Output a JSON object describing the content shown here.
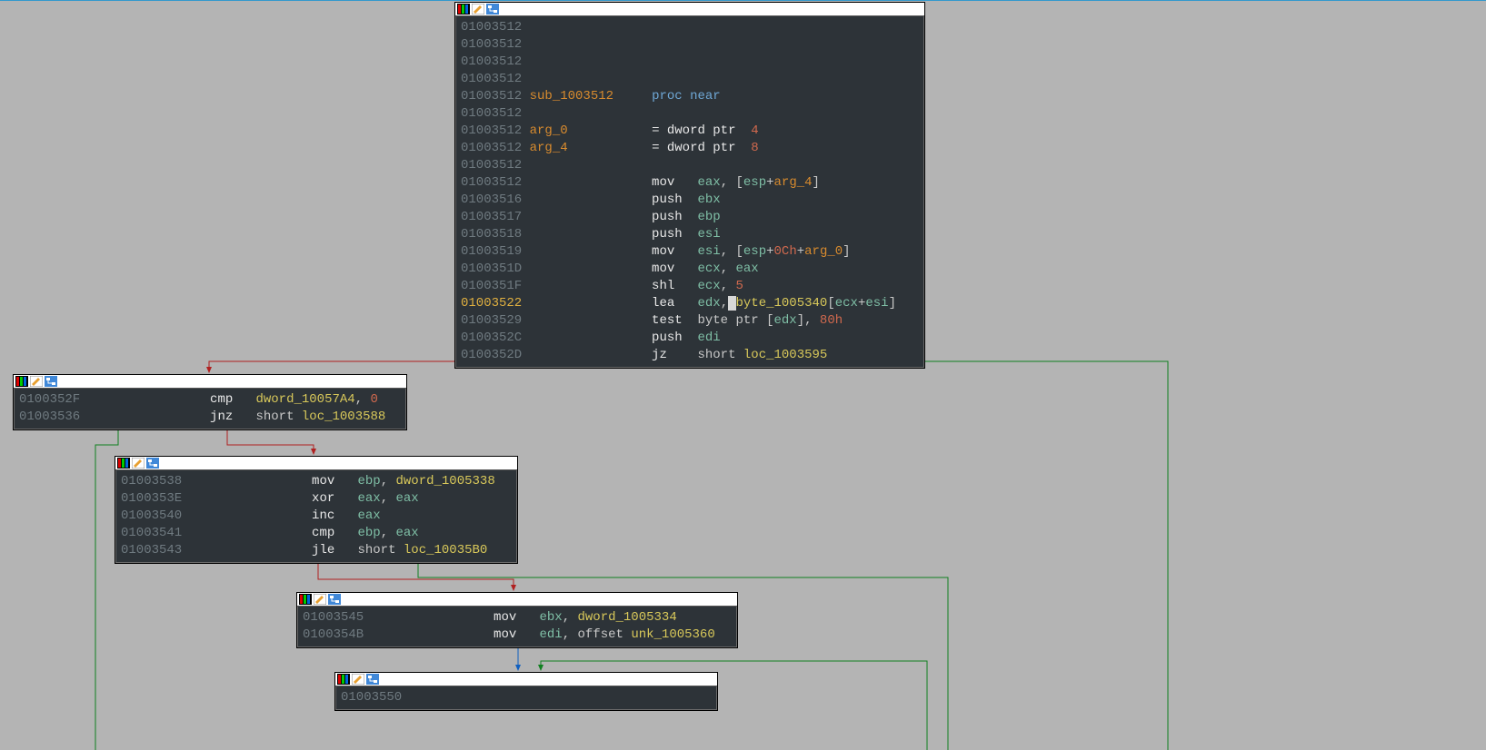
{
  "blocks": {
    "main": {
      "lines": [
        {
          "addr": "01003512",
          "asm": ""
        },
        {
          "addr": "01003512",
          "asm": ""
        },
        {
          "addr": "01003512",
          "asm": ""
        },
        {
          "addr": "01003512",
          "asm": ""
        },
        {
          "addr": "01003512",
          "asm": "<span class='id'>sub_1003512</span>     <span class='kw'>proc near</span>"
        },
        {
          "addr": "01003512",
          "asm": ""
        },
        {
          "addr": "01003512",
          "asm": "<span class='id'>arg_0</span>           <span class='op'>= dword ptr  </span><span class='num'>4</span>"
        },
        {
          "addr": "01003512",
          "asm": "<span class='id'>arg_4</span>           <span class='op'>= dword ptr  </span><span class='num'>8</span>"
        },
        {
          "addr": "01003512",
          "asm": ""
        },
        {
          "addr": "01003512",
          "asm": "                <span class='op'>mov   </span><span class='reg'>eax</span><span class='txt'>, [</span><span class='reg'>esp</span><span class='txt'>+</span><span class='id'>arg_4</span><span class='txt'>]</span>"
        },
        {
          "addr": "01003516",
          "asm": "                <span class='op'>push  </span><span class='reg'>ebx</span>"
        },
        {
          "addr": "01003517",
          "asm": "                <span class='op'>push  </span><span class='reg'>ebp</span>"
        },
        {
          "addr": "01003518",
          "asm": "                <span class='op'>push  </span><span class='reg'>esi</span>"
        },
        {
          "addr": "01003519",
          "asm": "                <span class='op'>mov   </span><span class='reg'>esi</span><span class='txt'>, [</span><span class='reg'>esp</span><span class='txt'>+</span><span class='num'>0Ch</span><span class='txt'>+</span><span class='id'>arg_0</span><span class='txt'>]</span>"
        },
        {
          "addr": "0100351D",
          "asm": "                <span class='op'>mov   </span><span class='reg'>ecx</span><span class='txt'>, </span><span class='reg'>eax</span>"
        },
        {
          "addr": "0100351F",
          "asm": "                <span class='op'>shl   </span><span class='reg'>ecx</span><span class='txt'>, </span><span class='num'>5</span>"
        },
        {
          "addr": "01003522",
          "hi": true,
          "asm": "                <span class='op'>lea   </span><span class='reg'>edx</span><span class='txt'>,</span><span style='background:#d8d8d8;color:#000'>&nbsp;</span><span class='lbl'>byte_1005340</span><span class='txt'>[</span><span class='reg'>ecx</span><span class='txt'>+</span><span class='reg'>esi</span><span class='txt'>]</span>"
        },
        {
          "addr": "01003529",
          "asm": "                <span class='op'>test  </span><span class='txt'>byte ptr [</span><span class='reg'>edx</span><span class='txt'>], </span><span class='num'>80h</span>"
        },
        {
          "addr": "0100352C",
          "asm": "                <span class='op'>push  </span><span class='reg'>edi</span>"
        },
        {
          "addr": "0100352D",
          "asm": "                <span class='op'>jz    </span><span class='txt'>short </span><span class='lbl'>loc_1003595</span>"
        }
      ]
    },
    "b2": {
      "lines": [
        {
          "addr": "0100352F",
          "asm": "                <span class='op'>cmp   </span><span class='lbl'>dword_10057A4</span><span class='txt'>, </span><span class='num'>0</span>"
        },
        {
          "addr": "01003536",
          "asm": "                <span class='op'>jnz   </span><span class='txt'>short </span><span class='lbl'>loc_1003588</span>"
        }
      ]
    },
    "b3": {
      "lines": [
        {
          "addr": "01003538",
          "asm": "                <span class='op'>mov   </span><span class='reg'>ebp</span><span class='txt'>, </span><span class='lbl'>dword_1005338</span>"
        },
        {
          "addr": "0100353E",
          "asm": "                <span class='op'>xor   </span><span class='reg'>eax</span><span class='txt'>, </span><span class='reg'>eax</span>"
        },
        {
          "addr": "01003540",
          "asm": "                <span class='op'>inc   </span><span class='reg'>eax</span>"
        },
        {
          "addr": "01003541",
          "asm": "                <span class='op'>cmp   </span><span class='reg'>ebp</span><span class='txt'>, </span><span class='reg'>eax</span>"
        },
        {
          "addr": "01003543",
          "asm": "                <span class='op'>jle   </span><span class='txt'>short </span><span class='lbl'>loc_10035B0</span>"
        }
      ]
    },
    "b4": {
      "lines": [
        {
          "addr": "01003545",
          "asm": "                <span class='op'>mov   </span><span class='reg'>ebx</span><span class='txt'>, </span><span class='lbl'>dword_1005334</span>"
        },
        {
          "addr": "0100354B",
          "asm": "                <span class='op'>mov   </span><span class='reg'>edi</span><span class='txt'>, offset </span><span class='lbl'>unk_1005360</span>"
        }
      ]
    },
    "b5": {
      "lines": [
        {
          "addr": "01003550",
          "asm": ""
        }
      ]
    }
  }
}
